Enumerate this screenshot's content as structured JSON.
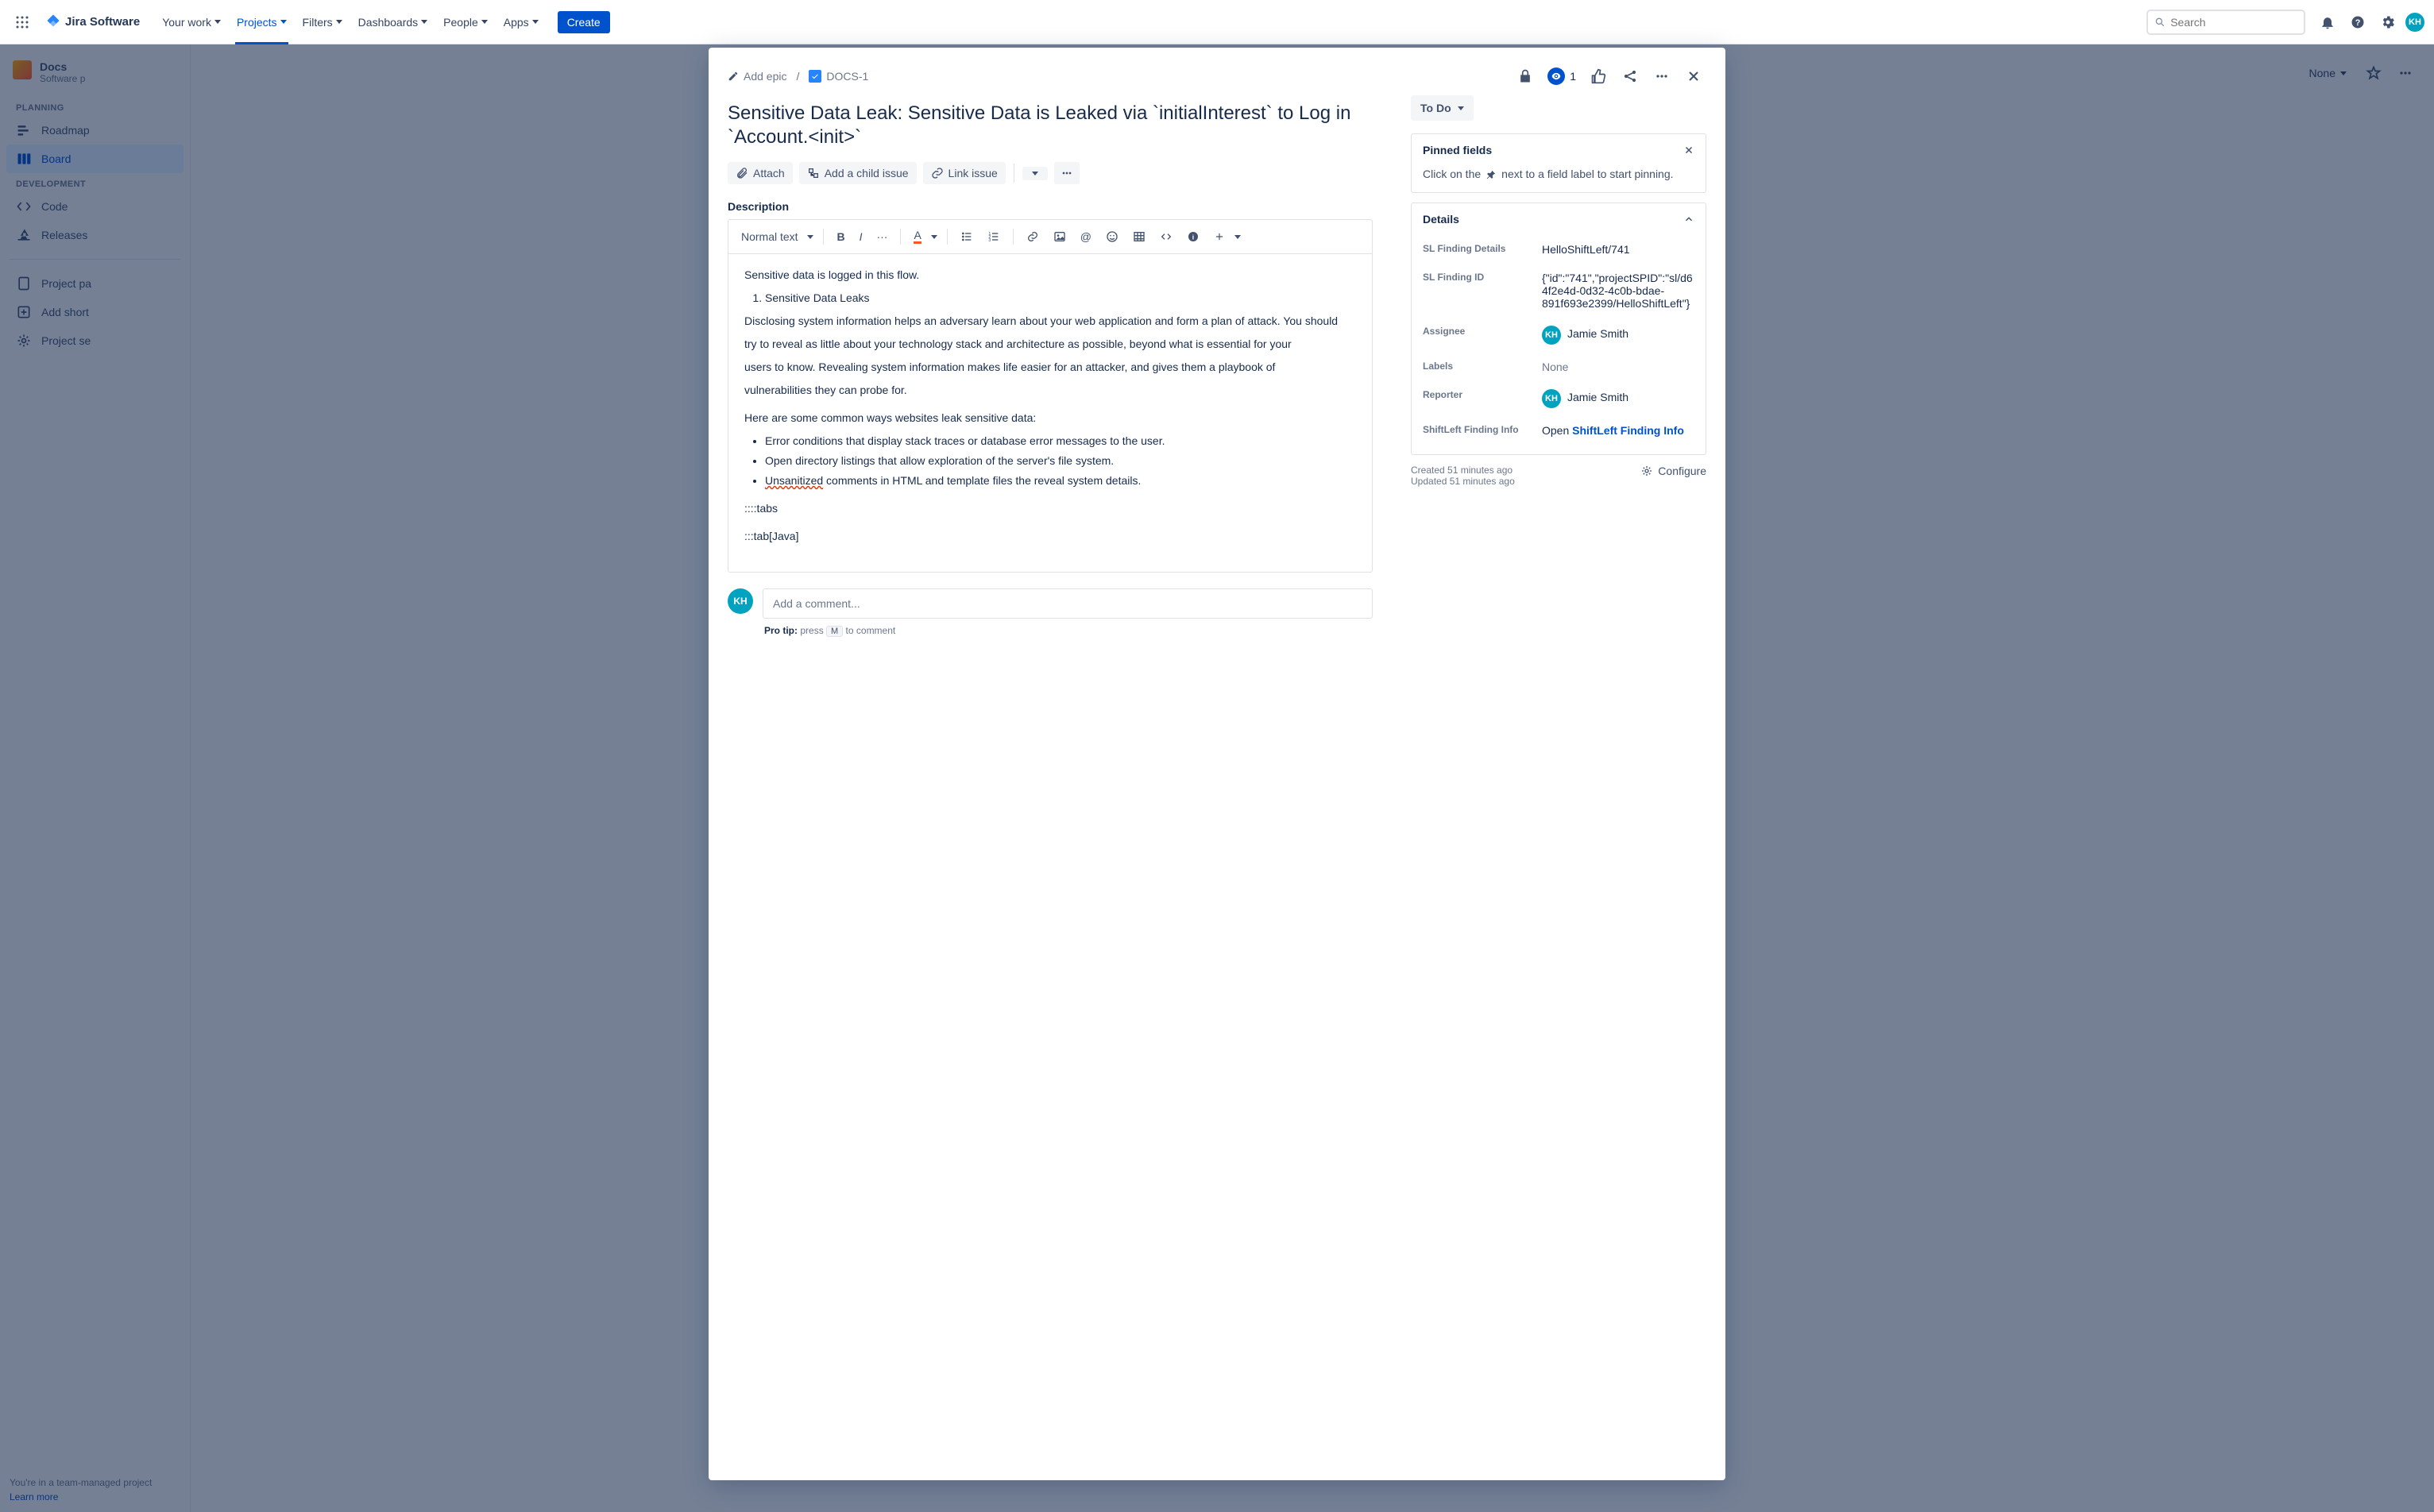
{
  "topnav": {
    "logo_text": "Jira Software",
    "links": {
      "your_work": "Your work",
      "projects": "Projects",
      "filters": "Filters",
      "dashboards": "Dashboards",
      "people": "People",
      "apps": "Apps"
    },
    "create": "Create",
    "search_placeholder": "Search",
    "avatar_initials": "KH"
  },
  "sidebar": {
    "project_name": "Docs",
    "project_type": "Software p",
    "groups": {
      "planning": "PLANNING",
      "development": "DEVELOPMENT"
    },
    "items": {
      "roadmap": "Roadmap",
      "board": "Board",
      "code": "Code",
      "releases": "Releases",
      "project_pages": "Project pa",
      "add_shortcut": "Add short",
      "project_settings": "Project se"
    },
    "footer_line": "You're in a team-managed project",
    "learn_more": "Learn more"
  },
  "main": {
    "filter_none": "None"
  },
  "issue": {
    "breadcrumbs": {
      "add_epic": "Add epic",
      "key": "DOCS-1"
    },
    "watchers_count": "1",
    "title": "Sensitive Data Leak: Sensitive Data is Leaked via `initialInterest` to Log in `Account.<init>`",
    "toolbar": {
      "attach": "Attach",
      "add_child": "Add a child issue",
      "link_issue": "Link issue"
    },
    "description_label": "Description",
    "editor_toolbar": {
      "text_style": "Normal text"
    },
    "description": {
      "p1": "Sensitive data is logged in this flow.",
      "ol1": "Sensitive Data Leaks",
      "p2a": "Disclosing system information helps an adversary learn about your web application and form a plan of attack. You should",
      "p2b": "try to reveal as little about your technology stack and architecture as possible, beyond what is essential for your",
      "p2c": "users to know. Revealing system information makes life easier for an attacker, and gives them a playbook of",
      "p2d": "vulnerabilities they can probe for.",
      "p3": "Here are some common ways websites leak sensitive data:",
      "ul1": "Error conditions that display stack traces or database error messages to the user.",
      "ul2": "Open directory listings that allow exploration of the server's file system.",
      "ul3a": "Unsanitized",
      "ul3b": " comments in HTML and template files the reveal system details.",
      "p4": "::::tabs",
      "p5": ":::tab[Java]"
    },
    "comment_placeholder": "Add a comment...",
    "pro_tip_label": "Pro tip:",
    "pro_tip_press": "press",
    "pro_tip_key": "M",
    "pro_tip_suffix": "to comment",
    "comment_avatar": "KH"
  },
  "right": {
    "status": "To Do",
    "pinned": {
      "title": "Pinned fields",
      "note_pre": "Click on the",
      "note_post": "next to a field label to start pinning."
    },
    "details": {
      "title": "Details",
      "fields": {
        "sl_finding_details_label": "SL Finding Details",
        "sl_finding_details_value": "HelloShiftLeft/741",
        "sl_finding_id_label": "SL Finding ID",
        "sl_finding_id_value": "{\"id\":\"741\",\"projectSPID\":\"sl/d64f2e4d-0d32-4c0b-bdae-891f693e2399/HelloShiftLeft\"}",
        "assignee_label": "Assignee",
        "assignee_value": "Jamie Smith",
        "labels_label": "Labels",
        "labels_value": "None",
        "reporter_label": "Reporter",
        "reporter_value": "Jamie Smith",
        "shiftleft_info_label": "ShiftLeft Finding Info",
        "shiftleft_info_open": "Open",
        "shiftleft_info_link": "ShiftLeft Finding Info"
      }
    },
    "created": "Created 51 minutes ago",
    "updated": "Updated 51 minutes ago",
    "configure": "Configure"
  }
}
